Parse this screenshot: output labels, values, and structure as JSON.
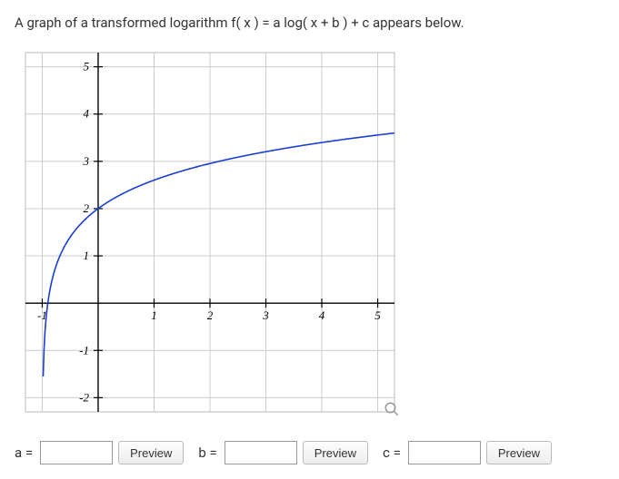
{
  "question": "A graph of a transformed logarithm f( x ) = a log( x + b ) + c appears below.",
  "answers": {
    "a": {
      "label": "a =",
      "value": "",
      "preview": "Preview"
    },
    "b": {
      "label": "b =",
      "value": "",
      "preview": "Preview"
    },
    "c": {
      "label": "c =",
      "value": "",
      "preview": "Preview"
    }
  },
  "chart_data": {
    "type": "line",
    "title": "",
    "xlabel": "",
    "ylabel": "",
    "xlim": [
      -1.3,
      5.3
    ],
    "ylim": [
      -2.3,
      5.3
    ],
    "x_ticks": [
      -1,
      1,
      2,
      3,
      4,
      5
    ],
    "y_ticks": [
      -2,
      -1,
      1,
      2,
      3,
      4,
      5
    ],
    "curve_description": "f(x) = 2·log10(x+1) + 2 (vertical asymptote at x = -1)",
    "sample_points": [
      {
        "x": -0.99,
        "y": -2.0
      },
      {
        "x": -0.9,
        "y": 0.0
      },
      {
        "x": -0.5,
        "y": 1.4
      },
      {
        "x": 0,
        "y": 2.0
      },
      {
        "x": 1,
        "y": 2.6
      },
      {
        "x": 2,
        "y": 2.95
      },
      {
        "x": 3,
        "y": 3.2
      },
      {
        "x": 4,
        "y": 3.4
      },
      {
        "x": 5,
        "y": 3.56
      }
    ]
  }
}
